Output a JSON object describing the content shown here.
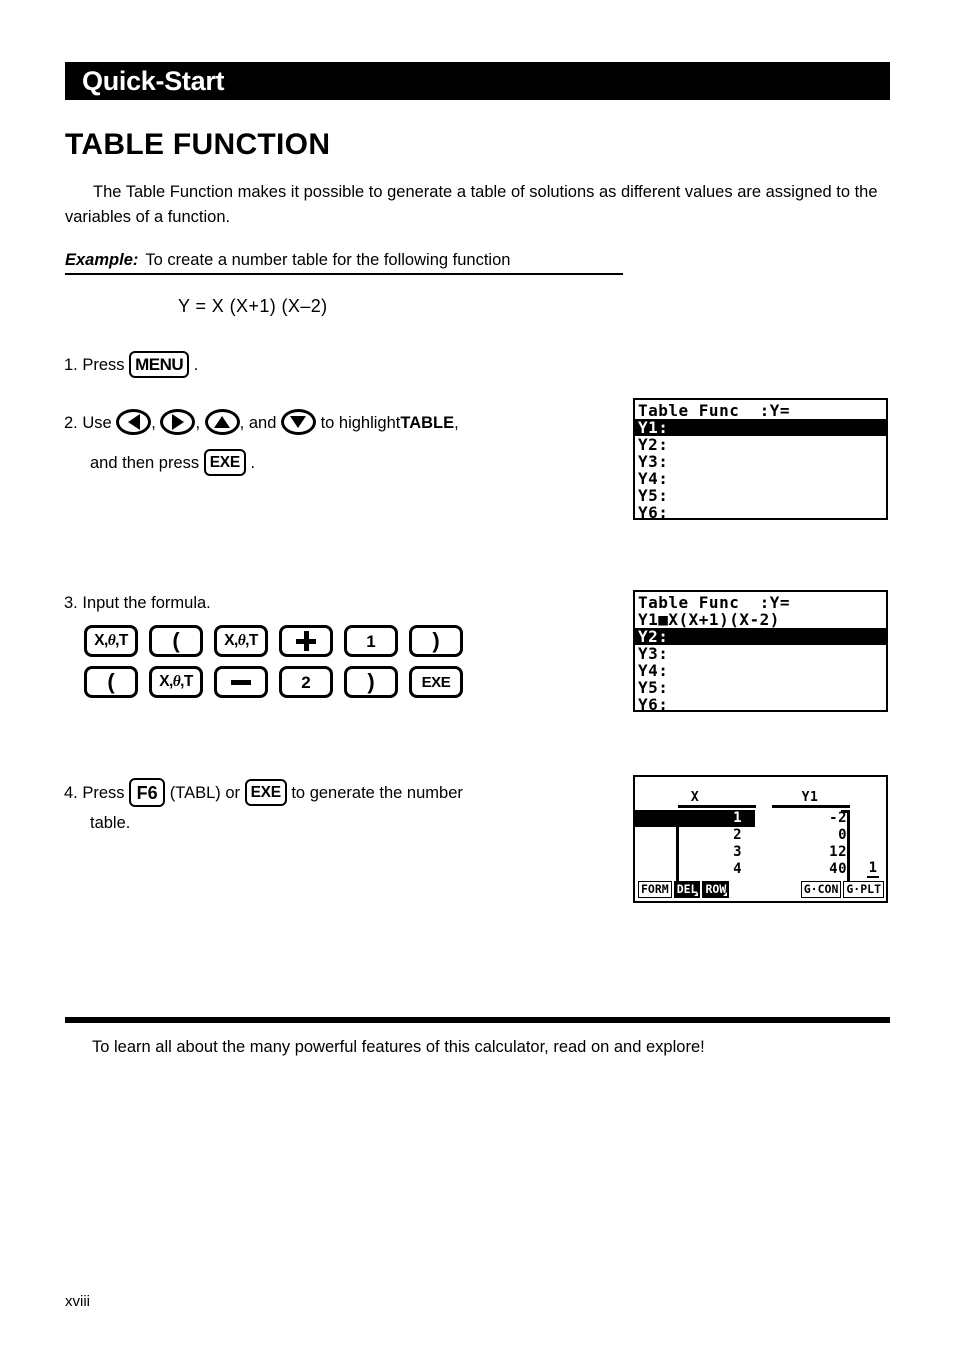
{
  "banner": {
    "title": "Quick-Start"
  },
  "section": {
    "title": "TABLE FUNCTION"
  },
  "intro": {
    "text": "The Table Function makes it possible to generate a table of solutions as different values are assigned to the variables of a function."
  },
  "example": {
    "label": "Example:",
    "text": "To create a number table for the following function",
    "formula": "Y = X (X+1) (X–2)"
  },
  "steps": {
    "step1": {
      "number": "1.",
      "verb": "Press",
      "key": "MENU",
      "period": "."
    },
    "step2": {
      "number": "2.",
      "verb": "Use",
      "keys": [
        "left-arrow",
        "right-arrow",
        "up-arrow",
        "down-arrow"
      ],
      "sep": ",",
      "and": ", and",
      "tail": "to highlight",
      "target": "TABLE",
      "comma": ",",
      "line2_pre": "and then press",
      "line2_key": "EXE",
      "line2_period": "."
    },
    "step3": {
      "number": "3.",
      "text": "Input the formula.",
      "keys_row1": [
        "X,θ,T",
        "(",
        "X,θ,T",
        "+",
        "1",
        ")"
      ],
      "keys_row2": [
        "(",
        "X,θ,T",
        "–",
        "2",
        ")",
        "EXE"
      ]
    },
    "step4": {
      "number": "4.",
      "verb": "Press",
      "key1": "F6",
      "paren": "(TABL)",
      "or": "or",
      "key2": "EXE",
      "tail": "to generate the number",
      "line2": "table."
    }
  },
  "screens": {
    "screen1": {
      "title": "Table Func  :Y=",
      "rows": [
        {
          "label": "Y1:",
          "selected": true
        },
        {
          "label": "Y2:",
          "selected": false
        },
        {
          "label": "Y3:",
          "selected": false
        },
        {
          "label": "Y4:",
          "selected": false
        },
        {
          "label": "Y5:",
          "selected": false
        },
        {
          "label": "Y6:",
          "selected": false
        }
      ]
    },
    "screen2": {
      "title": "Table Func  :Y=",
      "rows": [
        {
          "label": "Y1■X(X+1)(X-2)",
          "selected": false
        },
        {
          "label": "Y2:",
          "selected": true
        },
        {
          "label": "Y3:",
          "selected": false
        },
        {
          "label": "Y4:",
          "selected": false
        },
        {
          "label": "Y5:",
          "selected": false
        },
        {
          "label": "Y6:",
          "selected": false
        }
      ]
    },
    "screen3": {
      "col_x": "X",
      "col_y": "Y1",
      "rows": [
        {
          "x": "1",
          "y": "-2",
          "selected": true
        },
        {
          "x": "2",
          "y": "0",
          "selected": false
        },
        {
          "x": "3",
          "y": "12",
          "selected": false
        },
        {
          "x": "4",
          "y": "40",
          "selected": false
        }
      ],
      "page_indicator": "1",
      "fkeys": [
        {
          "label": "FORM",
          "inverted": false,
          "arrow": false
        },
        {
          "label": "DEL",
          "inverted": true,
          "arrow": true
        },
        {
          "label": "ROW",
          "inverted": true,
          "arrow": true
        }
      ],
      "fkeys_right": [
        {
          "label": "G·CON",
          "inverted": false,
          "arrow": false
        },
        {
          "label": "G·PLT",
          "inverted": false,
          "arrow": false
        }
      ]
    }
  },
  "closing": {
    "text": "To learn all about the many powerful features of this calculator, read on and explore!"
  },
  "folio": {
    "page": "xviii"
  },
  "colors": {
    "ink": "#000000",
    "paper": "#ffffff"
  }
}
